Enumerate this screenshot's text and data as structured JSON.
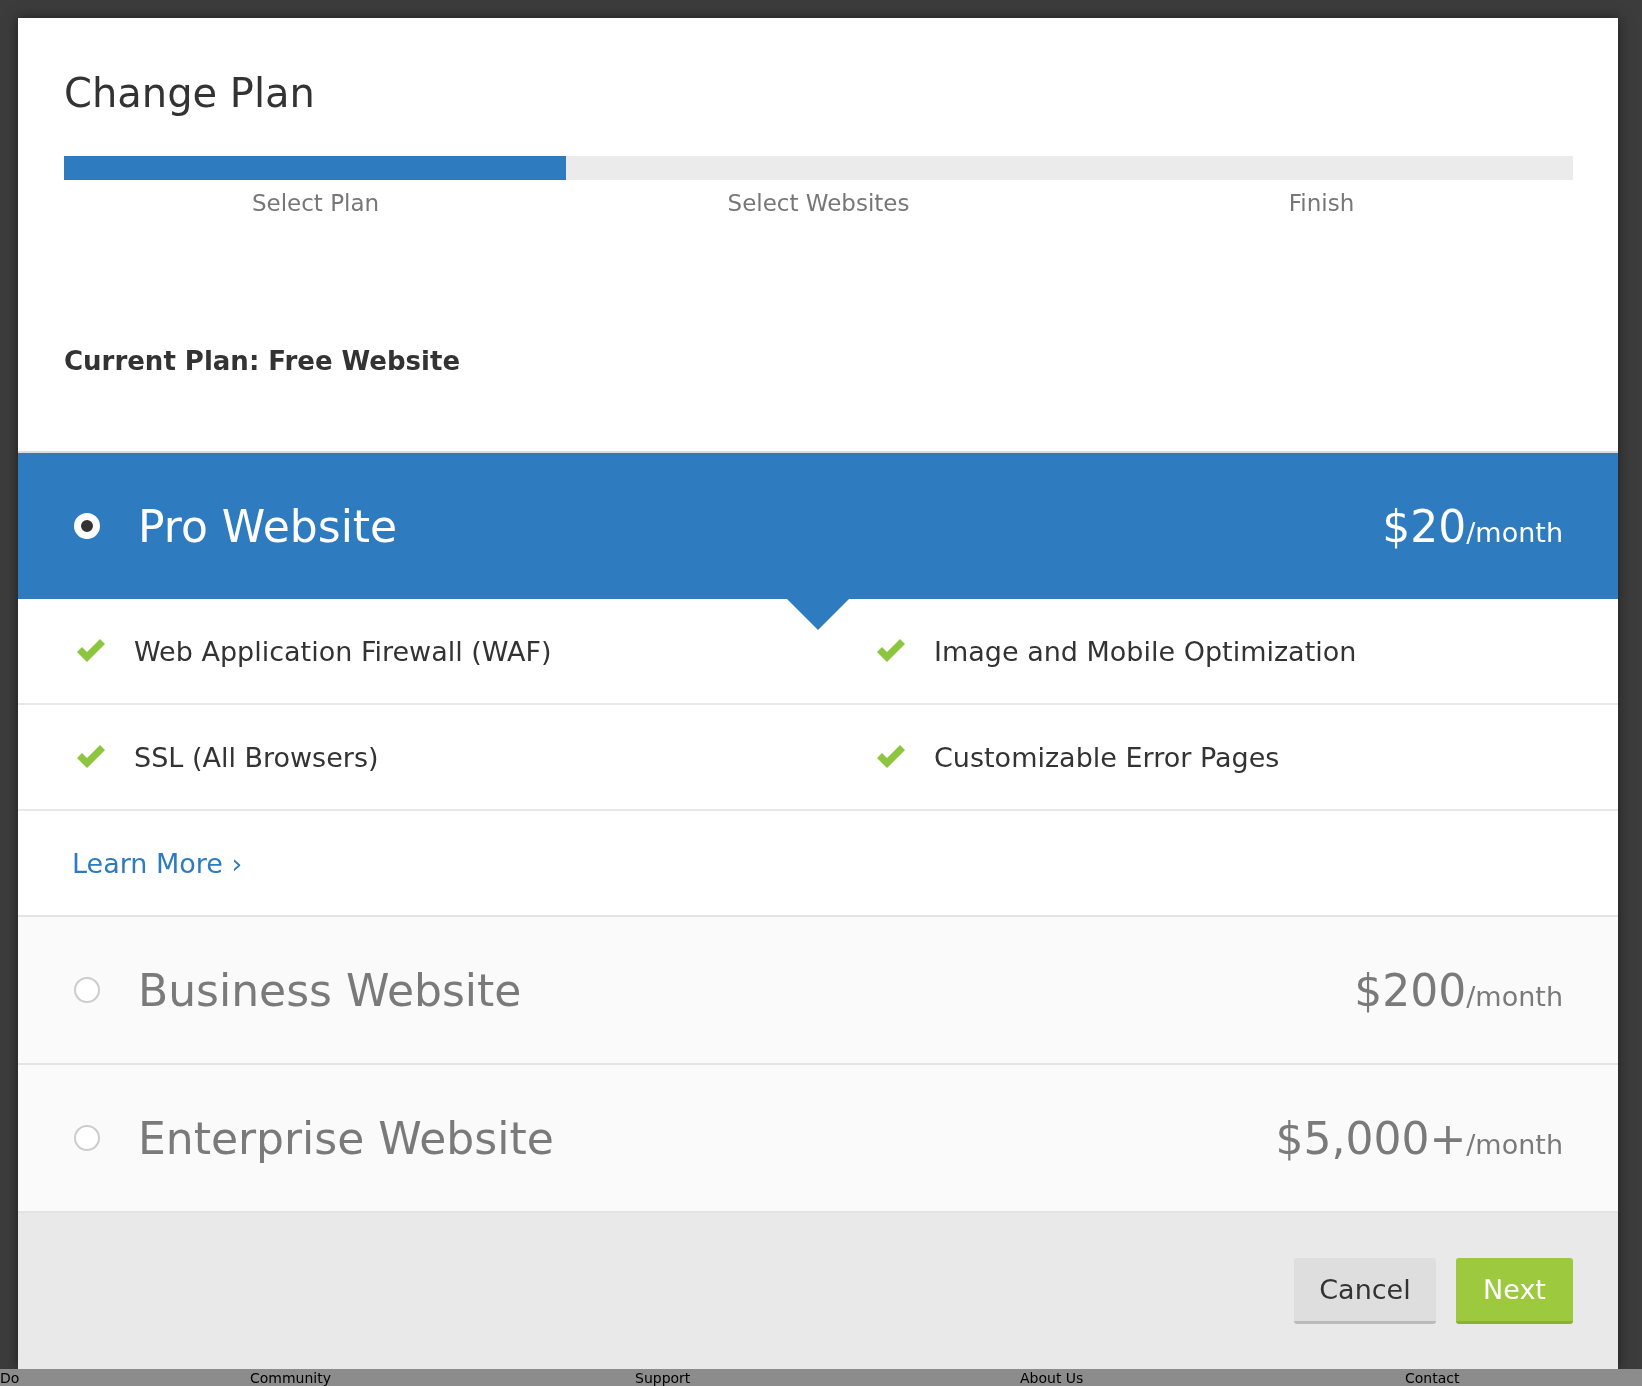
{
  "modal": {
    "title": "Change Plan",
    "progress": {
      "level": 0.333,
      "steps": [
        {
          "label": "Select Plan"
        },
        {
          "label": "Select Websites"
        },
        {
          "label": "Finish"
        }
      ]
    },
    "current_plan": "Current Plan: Free Website",
    "plans": [
      {
        "name": "Pro Website",
        "price": "$20",
        "period": "/month",
        "selected": true,
        "features": [
          "Web Application Firewall (WAF)",
          "Image and Mobile Optimization",
          "SSL (All Browsers)",
          "Customizable Error Pages"
        ],
        "link": "Learn More ›"
      },
      {
        "name": "Business Website",
        "price": "$200",
        "period": "/month",
        "selected": false
      },
      {
        "name": "Enterprise Website",
        "price": "$5,000+",
        "period": "/month",
        "selected": false
      }
    ],
    "buttons": [
      {
        "label": "Cancel",
        "kind": "secondary"
      },
      {
        "label": "Next",
        "kind": "primary"
      }
    ]
  },
  "footer_links": [
    "Do",
    "Community",
    "Support",
    "About Us",
    "Contact"
  ]
}
